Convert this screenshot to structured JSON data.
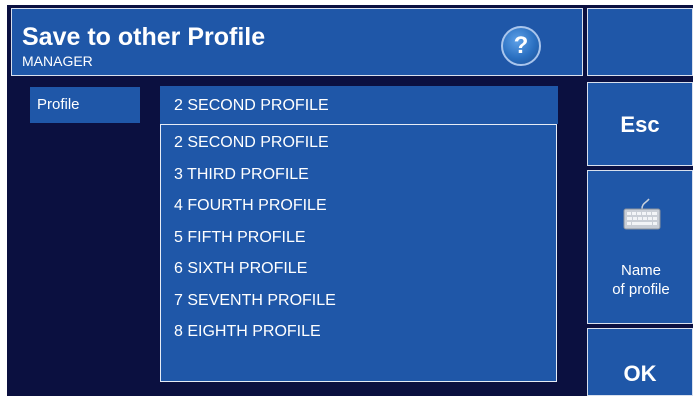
{
  "header": {
    "title": "Save to other Profile",
    "subtitle": "MANAGER",
    "help_label": "?"
  },
  "sidebar_buttons": {
    "esc_label": "Esc",
    "name_line1": "Name",
    "name_line2": "of profile",
    "ok_label": "OK"
  },
  "profile_field": {
    "label": "Profile",
    "selected": "2 SECOND PROFILE",
    "options": [
      "2 SECOND PROFILE",
      "3 THIRD PROFILE",
      "4 FOURTH PROFILE",
      "5 FIFTH PROFILE",
      "6 SIXTH PROFILE",
      "7 SEVENTH PROFILE",
      "8 EIGHTH PROFILE"
    ]
  },
  "colors": {
    "panel_blue": "#1f57a8",
    "background_navy": "#0b1040",
    "text": "#ffffff"
  }
}
